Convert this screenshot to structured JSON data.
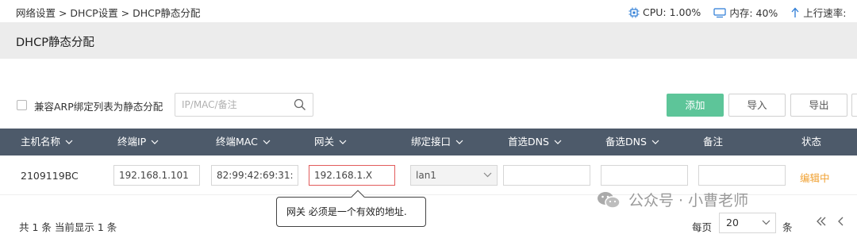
{
  "breadcrumb": "网络设置 > DHCP设置 > DHCP静态分配",
  "stats": {
    "cpu": "CPU: 1.00%",
    "memory": "内存: 40%",
    "upload": "上行速率:"
  },
  "title": "DHCP静态分配",
  "toolbar": {
    "checkbox_label": "兼容ARP绑定列表为静态分配",
    "search_placeholder": "IP/MAC/备注",
    "add_label": "添加",
    "import_label": "导入",
    "export_label": "导出"
  },
  "table": {
    "columns": [
      "主机名称",
      "终端IP",
      "终端MAC",
      "网关",
      "绑定接口",
      "首选DNS",
      "备选DNS",
      "备注",
      "状态"
    ],
    "row": {
      "hostname": "2109119BC",
      "ip": "192.168.1.101",
      "mac": "82:99:42:69:31:",
      "gateway": "192.168.1.X",
      "interface": "lan1",
      "dns1": "",
      "dns2": "",
      "note": "",
      "status": "编辑中"
    }
  },
  "tooltip": "网关 必须是一个有效的地址.",
  "footer": {
    "summary": "共 1 条 当前显示 1 条",
    "per_page_label": "每页",
    "per_page_value": "20",
    "per_page_unit": "条",
    "first_icon": "«",
    "prev_icon": "‹"
  },
  "watermark": "公众号 · 小曹老师",
  "colors": {
    "header_bg": "#4d5a6a",
    "add_button": "#5dc599",
    "status_editing": "#f0a030",
    "error_border": "#e25c5c"
  }
}
